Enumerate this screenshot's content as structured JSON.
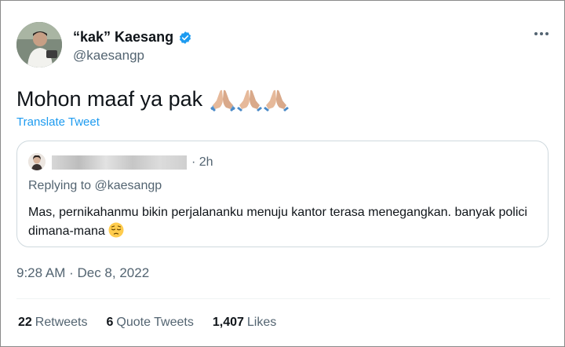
{
  "author": {
    "display_name": "“kak” Kaesang",
    "handle": "@kaesangp",
    "verified": true
  },
  "tweet": {
    "text": "Mohon maaf ya pak",
    "emojis": [
      "folded-hands",
      "folded-hands",
      "folded-hands"
    ],
    "translate_label": "Translate Tweet",
    "timestamp": "9:28 AM · Dec 8, 2022"
  },
  "quote": {
    "time": "· 2h",
    "replying_prefix": "Replying to ",
    "replying_handle": "@kaesangp",
    "body": "Mas, pernikahanmu bikin perjalananku menuju kantor terasa menegangkan. banyak polici dimana-mana",
    "emoji": "pensive-face"
  },
  "stats": [
    {
      "count": "22",
      "label": "Retweets"
    },
    {
      "count": "6",
      "label": "Quote Tweets"
    },
    {
      "count": "1,407",
      "label": "Likes"
    }
  ],
  "colors": {
    "link": "#1d9bf0",
    "secondary_text": "#536471",
    "primary_text": "#0f1419",
    "border": "#cfd9de"
  }
}
